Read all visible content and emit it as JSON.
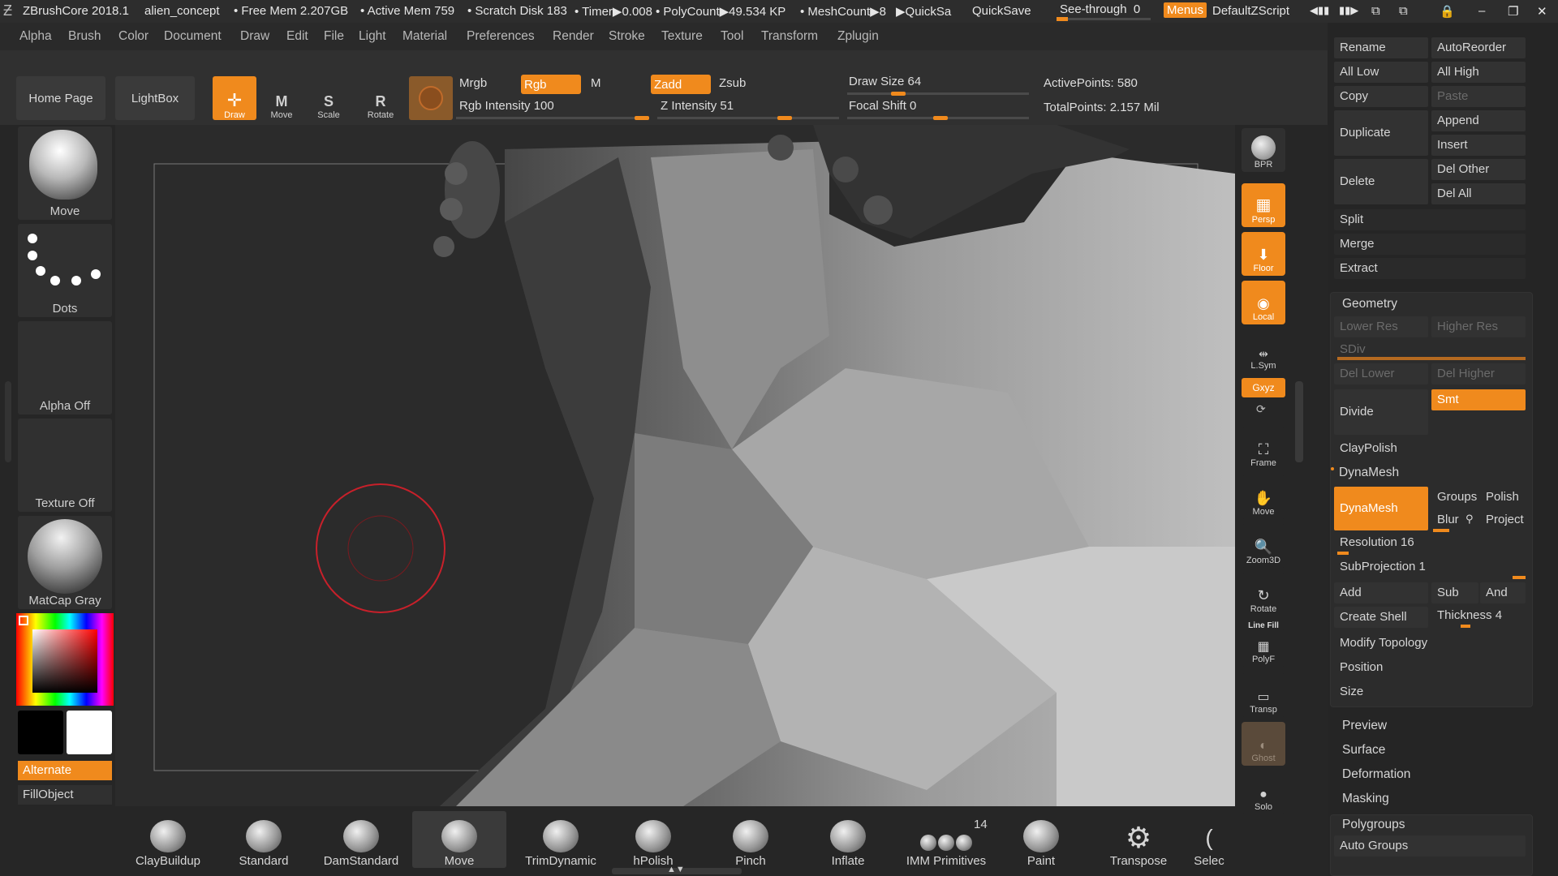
{
  "title_bar": {
    "app": "ZBrushCore 2018.1",
    "doc": "alien_concept",
    "free_mem": "• Free Mem 2.207GB",
    "active_mem": "• Active Mem 759",
    "scratch": "• Scratch Disk 183",
    "timer": "• Timer▶0.008",
    "polycount": "• PolyCount▶49.534 KP",
    "meshcount": "• MeshCount▶8",
    "quicksa": "▶QuickSa",
    "quicksave": "QuickSave",
    "see_through": "See-through",
    "see_through_value": "0",
    "menus": "Menus",
    "script": "DefaultZScript"
  },
  "menu": [
    "Alpha",
    "Brush",
    "Color",
    "Document",
    "Draw",
    "Edit",
    "File",
    "Light",
    "Material",
    "Preferences",
    "Render",
    "Stroke",
    "Texture",
    "Tool",
    "Transform",
    "Zplugin"
  ],
  "toolbar": {
    "home_page": "Home Page",
    "lightbox": "LightBox",
    "draw": "Draw",
    "move": "Move",
    "scale": "Scale",
    "rotate": "Rotate",
    "move_key": "M",
    "scale_key": "S",
    "rotate_key": "R",
    "mrgb": "Mrgb",
    "rgb": "Rgb",
    "m": "M",
    "zadd": "Zadd",
    "zsub": "Zsub",
    "rgb_intensity": "Rgb Intensity 100",
    "z_intensity": "Z Intensity 51",
    "draw_size": "Draw Size 64",
    "focal_shift": "Focal Shift 0",
    "active_points": "ActivePoints: 580",
    "total_points": "TotalPoints: 2.157 Mil"
  },
  "left": {
    "brush": "Move",
    "stroke": "Dots",
    "alpha": "Alpha Off",
    "texture": "Texture Off",
    "material": "MatCap Gray",
    "alternate": "Alternate",
    "fillobject": "FillObject"
  },
  "right_shelf": {
    "bpr": "BPR",
    "persp": "Persp",
    "floor": "Floor",
    "local": "Local",
    "lsym": "L.Sym",
    "xyz": "Gxyz",
    "frame": "Frame",
    "move": "Move",
    "zoom3d": "Zoom3D",
    "rotate": "Rotate",
    "line_fill": "Line Fill",
    "polyf": "PolyF",
    "transp": "Transp",
    "ghost": "Ghost",
    "solo": "Solo"
  },
  "subtool": {
    "rename": "Rename",
    "autoreorder": "AutoReorder",
    "all_low": "All Low",
    "all_high": "All High",
    "copy": "Copy",
    "paste": "Paste",
    "duplicate": "Duplicate",
    "append": "Append",
    "insert": "Insert",
    "delete": "Delete",
    "del_other": "Del Other",
    "del_all": "Del All",
    "split": "Split",
    "merge": "Merge",
    "extract": "Extract"
  },
  "geometry": {
    "title": "Geometry",
    "lower_res": "Lower Res",
    "higher_res": "Higher Res",
    "sdiv": "SDiv",
    "del_lower": "Del Lower",
    "del_higher": "Del Higher",
    "divide": "Divide",
    "smt": "Smt",
    "claypolish": "ClayPolish",
    "dynamesh_title": "DynaMesh",
    "dynamesh": "DynaMesh",
    "groups": "Groups",
    "polish": "Polish",
    "blur": "Blur",
    "project": "Project",
    "resolution": "Resolution 16",
    "subprojection": "SubProjection 1",
    "add": "Add",
    "sub": "Sub",
    "and": "And",
    "create_shell": "Create Shell",
    "thickness": "Thickness 4",
    "modify_topology": "Modify Topology",
    "position": "Position",
    "size": "Size"
  },
  "panel_sections": [
    "Preview",
    "Surface",
    "Deformation",
    "Masking"
  ],
  "polygroups": {
    "title": "Polygroups",
    "auto_groups": "Auto Groups"
  },
  "bottom_brushes": [
    {
      "label": "ClayBuildup"
    },
    {
      "label": "Standard"
    },
    {
      "label": "DamStandard"
    },
    {
      "label": "Move"
    },
    {
      "label": "TrimDynamic"
    },
    {
      "label": "hPolish"
    },
    {
      "label": "Pinch"
    },
    {
      "label": "Inflate"
    },
    {
      "label": "IMM Primitives",
      "count": "14"
    },
    {
      "label": "Paint"
    },
    {
      "label": "Transpose"
    },
    {
      "label": "Selec"
    }
  ],
  "colors": {
    "accent": "#f08a1d",
    "background": "#262626",
    "panel": "#303030"
  }
}
